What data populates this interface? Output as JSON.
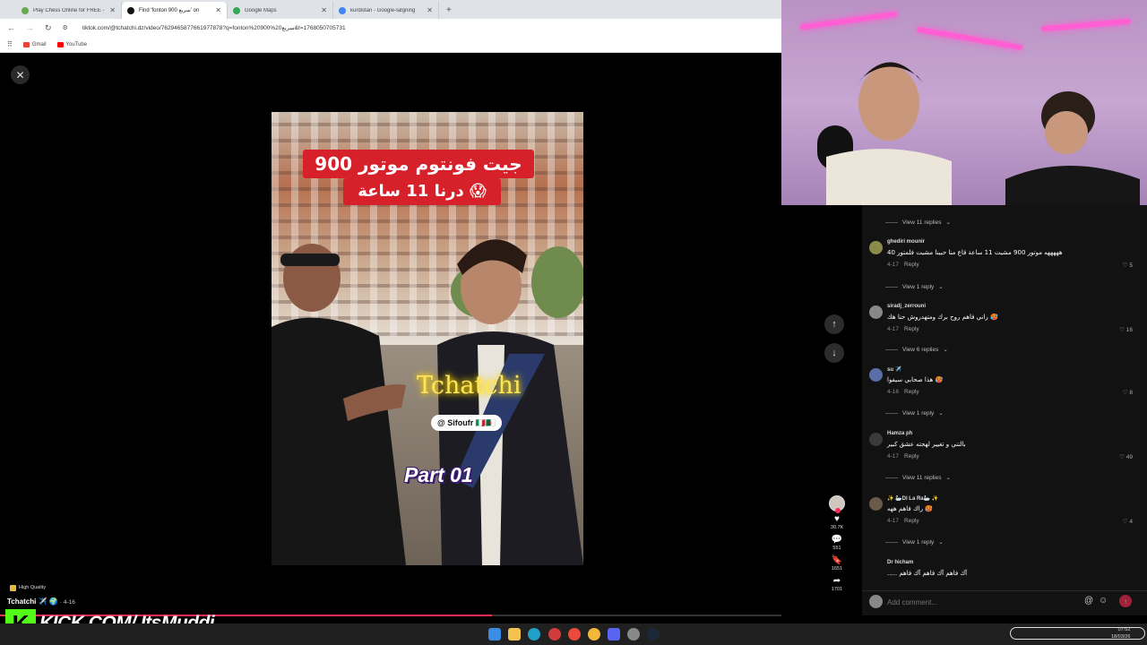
{
  "browser": {
    "tabs": [
      {
        "title": "Play Chess Online for FREE - 2",
        "color": "#6aa84f",
        "active": false
      },
      {
        "title": "Find 'fonton 900 سريع' on",
        "color": "#111111",
        "active": true
      },
      {
        "title": "Google Maps",
        "color": "#34a853",
        "active": false
      },
      {
        "title": "kurdistan - Google-søgning",
        "color": "#4285f4",
        "active": false
      }
    ],
    "new_tab": "+",
    "url": "tiktok.com/@tchatchi.dz/video/7629465877661977878?q=fonton%20900%20سريع&t=1768050705731",
    "bookmarks": [
      {
        "label": "Gmail",
        "color": "#ea4335"
      },
      {
        "label": "YouTube",
        "color": "#ff0000"
      }
    ]
  },
  "video": {
    "title_line1": "جيت فونتوم موتور 900",
    "title_line2": "درنا 11 ساعة 😱",
    "watermark": "Tchatchi",
    "handle": "@ Sifoufr 🇮🇹🇩🇿",
    "part": "Part 01"
  },
  "actions": {
    "likes": "30.7K",
    "comments": "551",
    "saves": "1651",
    "shares": "1701"
  },
  "author": {
    "name": "Tchatchi ✈️ 🌍",
    "date": "· 4-16",
    "quality": "High Quality"
  },
  "progress": {
    "fraction": 0.63
  },
  "kick": {
    "logo": "K",
    "text": "KICK.COM/ ItsMuddi"
  },
  "comments": {
    "view_replies_top": "View 11 replies",
    "items": [
      {
        "user": "ghediri mounir",
        "text": "هههههه موتور 900 مشيت 11 ساعة قاع منا حبينا مشيت فلمتور 40",
        "date": "4-17",
        "reply": "Reply",
        "likes": "5",
        "avatar_color": "#8a8a4a",
        "replies": "View 1 reply"
      },
      {
        "user": "siradj_zerrouni",
        "text": "راني فاهم روح برك ومتهدروش حنا هك 🥵",
        "date": "4-17",
        "reply": "Reply",
        "likes": "16",
        "avatar_color": "#888888",
        "replies": "View 6 replies"
      },
      {
        "user": "su ✈️",
        "text": "هذا صحابي سيفوا 🥵",
        "date": "4-16",
        "reply": "Reply",
        "likes": "8",
        "avatar_color": "#5a6ea8",
        "replies": "View 1 reply"
      },
      {
        "user": "Hamza ph",
        "text": "بالتني و تغيير لهجته عشق كبير",
        "date": "4-17",
        "reply": "Reply",
        "likes": "49",
        "avatar_color": "#3a3a3a",
        "replies": "View 11 replies"
      },
      {
        "user": "✨ 🦢Dl La Ra🦢 ✨",
        "text": "راك فاهم ههه 🥵",
        "date": "4-17",
        "reply": "Reply",
        "likes": "4",
        "avatar_color": "#6a5a4a",
        "replies": "View 1 reply"
      },
      {
        "user": "Dr hicham",
        "text": "..... آك فاهم آك فاهم آك فاهم",
        "date": "",
        "reply": "",
        "likes": "",
        "avatar_color": "#121212",
        "replies": ""
      }
    ],
    "compose_placeholder": "Add comment..."
  },
  "taskbar": {
    "time": "07:52",
    "date": "18/03/26"
  },
  "colors": {
    "accent": "#fe2c55",
    "kick_green": "#53fc18"
  }
}
